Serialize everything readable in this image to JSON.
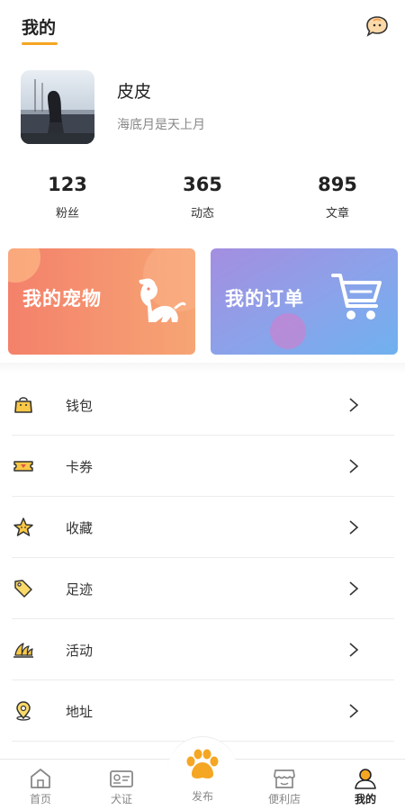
{
  "header": {
    "title": "我的"
  },
  "profile": {
    "name": "皮皮",
    "signature": "海底月是天上月"
  },
  "stats": [
    {
      "value": "123",
      "label": "粉丝"
    },
    {
      "value": "365",
      "label": "动态"
    },
    {
      "value": "895",
      "label": "文章"
    }
  ],
  "cards": {
    "pet": {
      "label": "我的宠物",
      "icon": "dog-icon"
    },
    "order": {
      "label": "我的订单",
      "icon": "shopping-cart-icon"
    }
  },
  "menu": {
    "items": [
      {
        "label": "钱包",
        "icon": "wallet-bag-icon"
      },
      {
        "label": "卡券",
        "icon": "ticket-icon"
      },
      {
        "label": "收藏",
        "icon": "star-icon"
      },
      {
        "label": "足迹",
        "icon": "tag-icon"
      },
      {
        "label": "活动",
        "icon": "opera-house-icon"
      },
      {
        "label": "地址",
        "icon": "location-pin-icon"
      }
    ]
  },
  "tabbar": {
    "tabs": [
      {
        "label": "首页",
        "icon": "home-icon"
      },
      {
        "label": "犬证",
        "icon": "id-card-icon"
      },
      {
        "label": "发布",
        "icon": "paw-icon"
      },
      {
        "label": "便利店",
        "icon": "store-icon"
      },
      {
        "label": "我的",
        "icon": "user-icon"
      }
    ],
    "active": "我的"
  },
  "colors": {
    "accent": "#f5a623",
    "pet_card": "#f4816b",
    "order_card": "#8aa3ea"
  }
}
